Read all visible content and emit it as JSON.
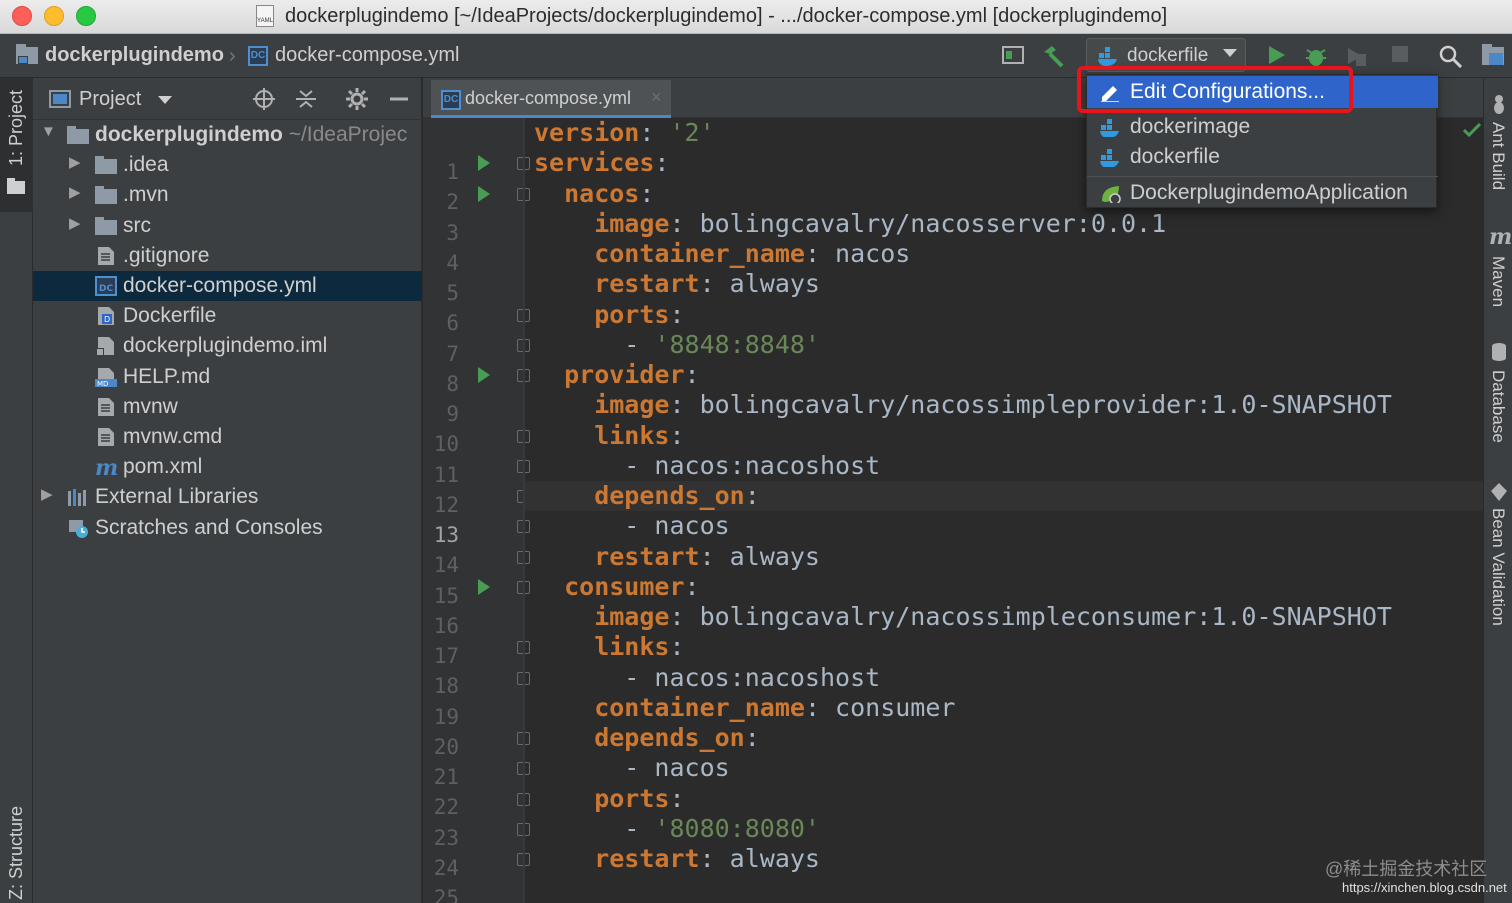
{
  "window": {
    "title": "dockerplugindemo [~/IdeaProjects/dockerplugindemo] - .../docker-compose.yml [dockerplugindemo]"
  },
  "navbar": {
    "project": "dockerplugindemo",
    "file": "docker-compose.yml",
    "run_config": "dockerfile"
  },
  "left_strip": {
    "project_tab": "1: Project",
    "structure_tab": "Z: Structure"
  },
  "project_panel": {
    "title": "Project",
    "tree": [
      {
        "label": "dockerplugindemo",
        "path": " ~/IdeaProjec",
        "icon": "folder-icon",
        "expanded": true
      },
      {
        "label": ".idea",
        "icon": "folder-icon"
      },
      {
        "label": ".mvn",
        "icon": "folder-icon"
      },
      {
        "label": "src",
        "icon": "folder-icon"
      },
      {
        "label": ".gitignore",
        "icon": "text-file-icon"
      },
      {
        "label": "docker-compose.yml",
        "icon": "docker-compose-file-icon",
        "selected": true
      },
      {
        "label": "Dockerfile",
        "icon": "dockerfile-icon"
      },
      {
        "label": "dockerplugindemo.iml",
        "icon": "module-file-icon"
      },
      {
        "label": "HELP.md",
        "icon": "markdown-file-icon"
      },
      {
        "label": "mvnw",
        "icon": "text-file-icon"
      },
      {
        "label": "mvnw.cmd",
        "icon": "text-file-icon"
      },
      {
        "label": "pom.xml",
        "icon": "maven-icon"
      },
      {
        "label": "External Libraries",
        "icon": "libraries-icon"
      },
      {
        "label": "Scratches and Consoles",
        "icon": "scratches-icon"
      }
    ]
  },
  "editor": {
    "tab": "docker-compose.yml",
    "current_line": 13,
    "lines": [
      [
        {
          "t": "version",
          "c": "k"
        },
        {
          "t": ": ",
          "c": ""
        },
        {
          "t": "'2'",
          "c": "s"
        }
      ],
      [
        {
          "t": "services",
          "c": "k"
        },
        {
          "t": ":",
          "c": ""
        }
      ],
      [
        {
          "t": "  nacos",
          "c": "k"
        },
        {
          "t": ":",
          "c": ""
        }
      ],
      [
        {
          "t": "    image",
          "c": "k"
        },
        {
          "t": ": bolingcavalry/nacosserver:0.0.1",
          "c": ""
        }
      ],
      [
        {
          "t": "    container_name",
          "c": "k"
        },
        {
          "t": ": nacos",
          "c": ""
        }
      ],
      [
        {
          "t": "    restart",
          "c": "k"
        },
        {
          "t": ": always",
          "c": ""
        }
      ],
      [
        {
          "t": "    ports",
          "c": "k"
        },
        {
          "t": ":",
          "c": ""
        }
      ],
      [
        {
          "t": "      - ",
          "c": ""
        },
        {
          "t": "'8848:8848'",
          "c": "s"
        }
      ],
      [
        {
          "t": "  provider",
          "c": "k"
        },
        {
          "t": ":",
          "c": ""
        }
      ],
      [
        {
          "t": "    image",
          "c": "k"
        },
        {
          "t": ": bolingcavalry/nacossimpleprovider:1.0-SNAPSHOT",
          "c": ""
        }
      ],
      [
        {
          "t": "    links",
          "c": "k"
        },
        {
          "t": ":",
          "c": ""
        }
      ],
      [
        {
          "t": "      - nacos:nacoshost",
          "c": ""
        }
      ],
      [
        {
          "t": "    depends_on",
          "c": "k"
        },
        {
          "t": ":",
          "c": ""
        }
      ],
      [
        {
          "t": "      - nacos",
          "c": ""
        }
      ],
      [
        {
          "t": "    restart",
          "c": "k"
        },
        {
          "t": ": always",
          "c": ""
        }
      ],
      [
        {
          "t": "  consumer",
          "c": "k"
        },
        {
          "t": ":",
          "c": ""
        }
      ],
      [
        {
          "t": "    image",
          "c": "k"
        },
        {
          "t": ": bolingcavalry/nacossimpleconsumer:1.0-SNAPSHOT",
          "c": ""
        }
      ],
      [
        {
          "t": "    links",
          "c": "k"
        },
        {
          "t": ":",
          "c": ""
        }
      ],
      [
        {
          "t": "      - nacos:nacoshost",
          "c": ""
        }
      ],
      [
        {
          "t": "    container_name",
          "c": "k"
        },
        {
          "t": ": consumer",
          "c": ""
        }
      ],
      [
        {
          "t": "    depends_on",
          "c": "k"
        },
        {
          "t": ":",
          "c": ""
        }
      ],
      [
        {
          "t": "      - nacos",
          "c": ""
        }
      ],
      [
        {
          "t": "    ports",
          "c": "k"
        },
        {
          "t": ":",
          "c": ""
        }
      ],
      [
        {
          "t": "      - ",
          "c": ""
        },
        {
          "t": "'8080:8080'",
          "c": "s"
        }
      ],
      [
        {
          "t": "    restart",
          "c": "k"
        },
        {
          "t": ": always",
          "c": ""
        }
      ]
    ],
    "run_marker_lines": [
      2,
      3,
      9,
      16
    ]
  },
  "dropdown": {
    "items": [
      {
        "label": "Edit Configurations...",
        "icon": "edit-pencil-icon",
        "active": true
      },
      {
        "label": "dockerimage",
        "icon": "docker-icon"
      },
      {
        "label": "dockerfile",
        "icon": "docker-icon"
      },
      {
        "label": "DockerplugindemoApplication",
        "icon": "spring-boot-icon"
      }
    ]
  },
  "right_strip": {
    "tabs": [
      "Ant Build",
      "Maven",
      "Database",
      "Bean Validation"
    ]
  },
  "watermark": {
    "text": "@稀土掘金技术社区",
    "url": "https://xinchen.blog.csdn.net"
  },
  "colors": {
    "keyword": "#cc7832",
    "string": "#6a8759",
    "plain": "#a9b7c6",
    "selection": "#2f65ca",
    "highlight_box": "#e8141c"
  }
}
